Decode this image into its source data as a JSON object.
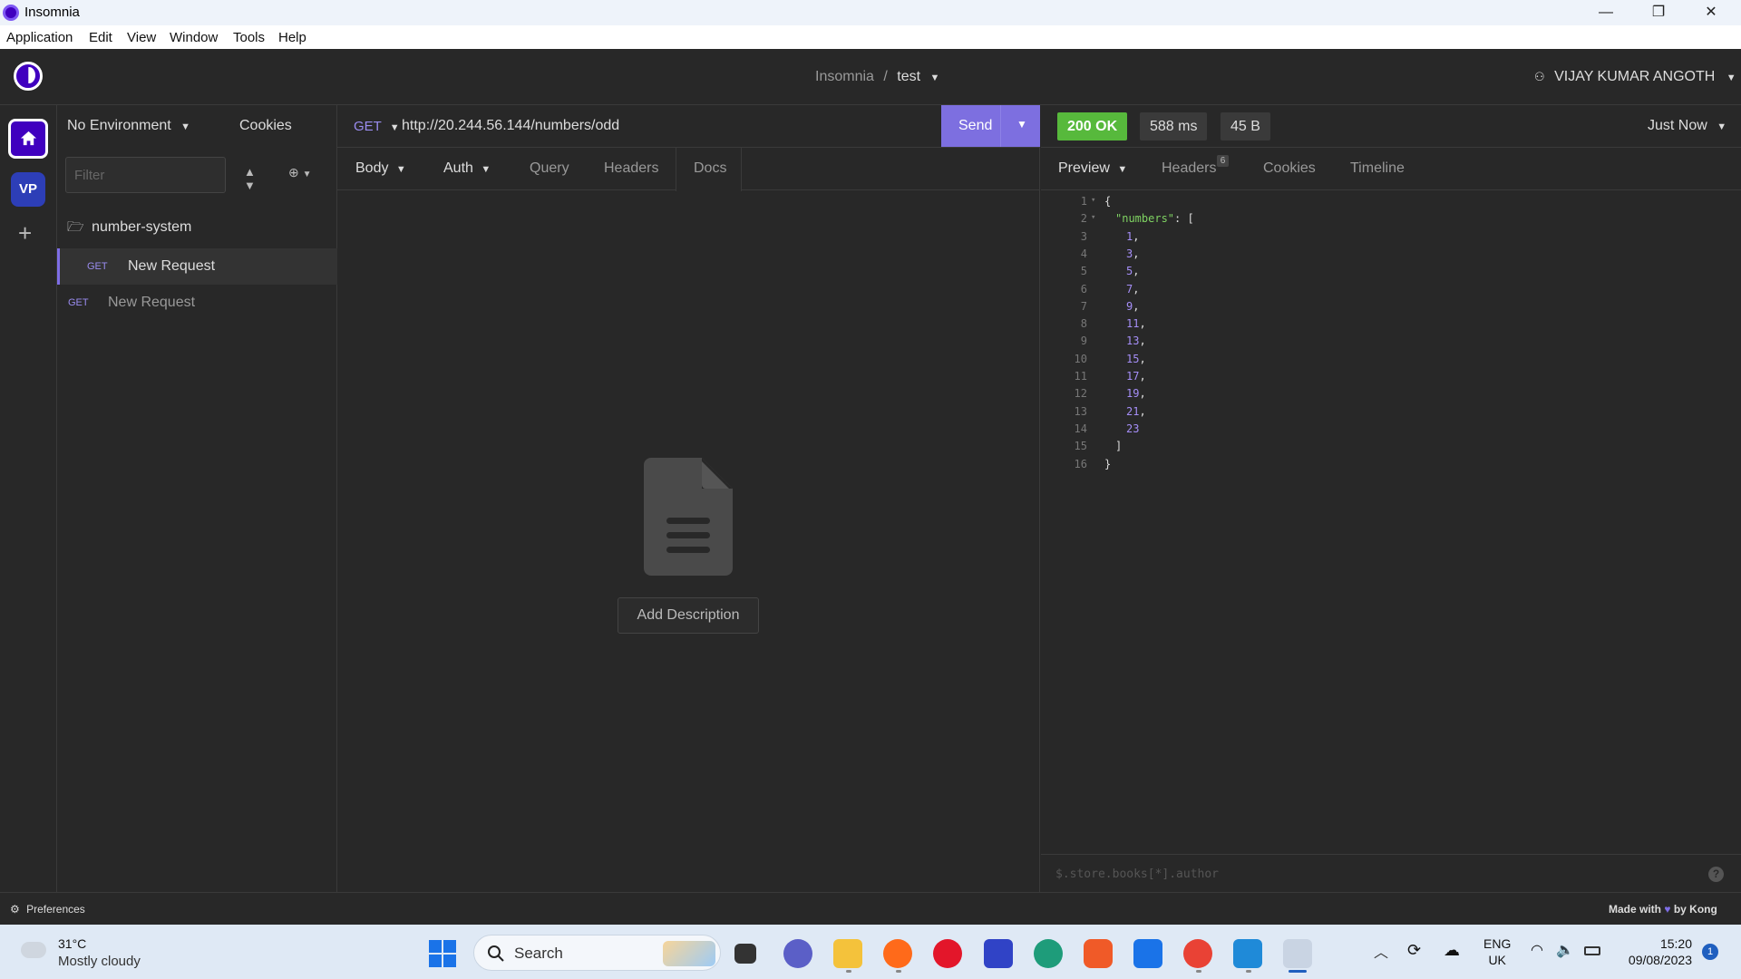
{
  "window": {
    "title": "Insomnia",
    "controls": [
      "—",
      "❐",
      "✕"
    ]
  },
  "menu": [
    "Application",
    "Edit",
    "View",
    "Window",
    "Tools",
    "Help"
  ],
  "header": {
    "breadcrumb_root": "Insomnia",
    "breadcrumb_sep": "/",
    "project": "test",
    "user": "VIJAY KUMAR ANGOTH"
  },
  "rail": {
    "org_initials": "VP",
    "add": "+"
  },
  "sidebar": {
    "environment": "No Environment",
    "cookies": "Cookies",
    "filter_placeholder": "Filter",
    "folder": "number-system",
    "requests": [
      {
        "method": "GET",
        "name": "New Request",
        "active": true
      },
      {
        "method": "GET",
        "name": "New Request",
        "active": false
      }
    ]
  },
  "request": {
    "method": "GET",
    "url": "http://20.244.56.144/numbers/odd",
    "send_label": "Send",
    "tabs": {
      "body": "Body",
      "auth": "Auth",
      "query": "Query",
      "headers": "Headers",
      "docs": "Docs"
    },
    "add_description": "Add Description"
  },
  "response": {
    "status": "200 OK",
    "time": "588 ms",
    "size": "45 B",
    "when": "Just Now",
    "tabs": {
      "preview": "Preview",
      "headers": "Headers",
      "headers_count": "6",
      "cookies": "Cookies",
      "timeline": "Timeline"
    },
    "lines": [
      {
        "n": "1",
        "fold": true,
        "indent": 0,
        "text": "{"
      },
      {
        "n": "2",
        "fold": true,
        "indent": 1,
        "key": "\"numbers\"",
        "rest": ": ["
      },
      {
        "n": "3",
        "indent": 2,
        "num": "1",
        "rest": ","
      },
      {
        "n": "4",
        "indent": 2,
        "num": "3",
        "rest": ","
      },
      {
        "n": "5",
        "indent": 2,
        "num": "5",
        "rest": ","
      },
      {
        "n": "6",
        "indent": 2,
        "num": "7",
        "rest": ","
      },
      {
        "n": "7",
        "indent": 2,
        "num": "9",
        "rest": ","
      },
      {
        "n": "8",
        "indent": 2,
        "num": "11",
        "rest": ","
      },
      {
        "n": "9",
        "indent": 2,
        "num": "13",
        "rest": ","
      },
      {
        "n": "10",
        "indent": 2,
        "num": "15",
        "rest": ","
      },
      {
        "n": "11",
        "indent": 2,
        "num": "17",
        "rest": ","
      },
      {
        "n": "12",
        "indent": 2,
        "num": "19",
        "rest": ","
      },
      {
        "n": "13",
        "indent": 2,
        "num": "21",
        "rest": ","
      },
      {
        "n": "14",
        "indent": 2,
        "num": "23",
        "rest": ""
      },
      {
        "n": "15",
        "indent": 1,
        "text": "]"
      },
      {
        "n": "16",
        "indent": 0,
        "text": "}"
      }
    ],
    "filter_placeholder": "$.store.books[*].author",
    "help": "?"
  },
  "statusbar": {
    "preferences": "Preferences",
    "made_with": "Made with",
    "by": "by Kong"
  },
  "taskbar": {
    "temp": "31°C",
    "weather": "Mostly cloudy",
    "search": "Search",
    "lang1": "ENG",
    "lang2": "UK",
    "time": "15:20",
    "date": "09/08/2023",
    "notifications": "1",
    "apps": [
      "task-view",
      "teams-chat",
      "file-explorer",
      "firefox",
      "opera",
      "editor",
      "edge",
      "brave",
      "mail",
      "chrome",
      "vscode",
      "insomnia"
    ]
  },
  "colors": {
    "accent": "#7d6fe0",
    "status_ok": "#57b93c",
    "json_key": "#7fd362",
    "json_number": "#a58ef7"
  }
}
